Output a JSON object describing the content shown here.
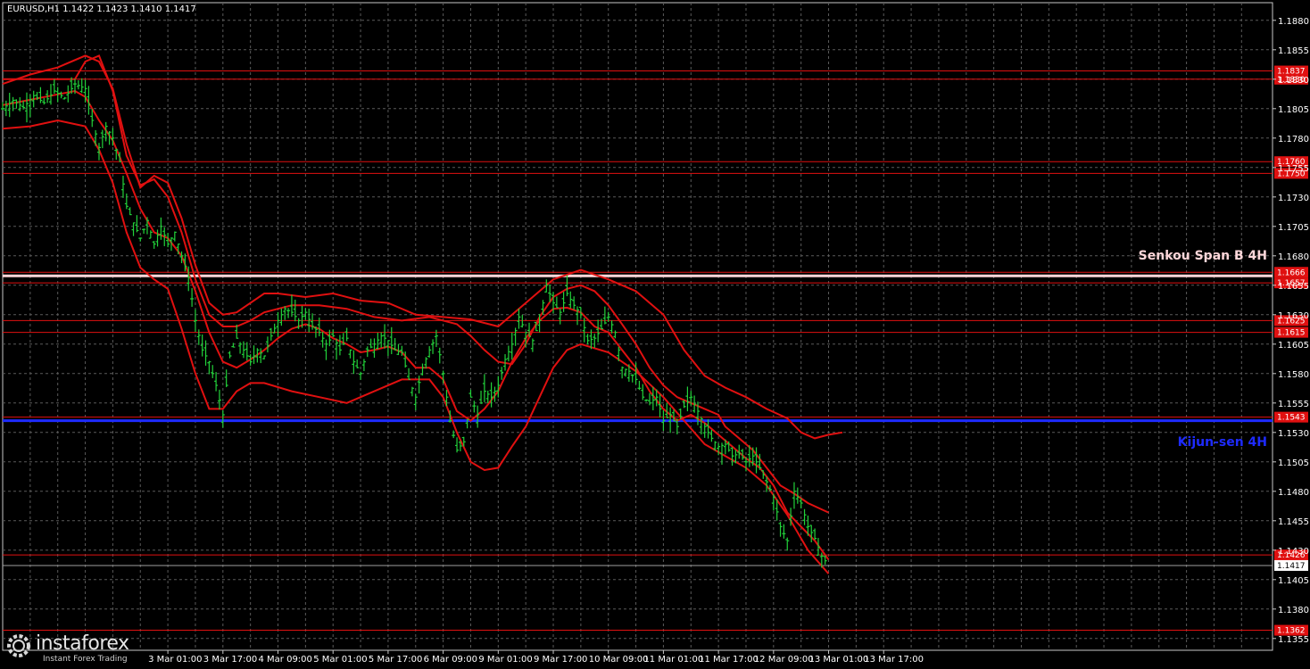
{
  "header": {
    "title": "EURUSD,H1  1.1422 1.1423 1.1410 1.1417"
  },
  "brand": {
    "name": "instaforex",
    "tagline": "Instant Forex Trading",
    "logo_icon": "gear-logo-icon"
  },
  "labels": {
    "senkou": "Senkou Span B 4H",
    "kijun": "Kijun-sen 4H"
  },
  "colors": {
    "background": "#000000",
    "candles": "#22d13a",
    "levels": "#e01010",
    "kijun": "#1e2bff",
    "senkou": "#ffd7da",
    "grid": "#5a5a5a"
  },
  "chart_data": {
    "type": "line",
    "title": "EURUSD,H1",
    "ylim": [
      1.1345,
      1.1895
    ],
    "grid": true,
    "y_ticks": [
      "1.1880",
      "1.1855",
      "1.1830",
      "1.1805",
      "1.1780",
      "1.1755",
      "1.1730",
      "1.1705",
      "1.1680",
      "1.1655",
      "1.1630",
      "1.1605",
      "1.1580",
      "1.1555",
      "1.1530",
      "1.1505",
      "1.1480",
      "1.1455",
      "1.1430",
      "1.1405",
      "1.1380",
      "1.1355"
    ],
    "x_ticks": [
      {
        "label": "3 Mar 01:00",
        "x": 1
      },
      {
        "label": "3 Mar 17:00",
        "x": 17
      },
      {
        "label": "4 Mar 09:00",
        "x": 33
      },
      {
        "label": "5 Mar 01:00",
        "x": 49
      },
      {
        "label": "5 Mar 17:00",
        "x": 65
      },
      {
        "label": "6 Mar 09:00",
        "x": 81
      },
      {
        "label": "9 Mar 01:00",
        "x": 97
      },
      {
        "label": "9 Mar 17:00",
        "x": 113
      },
      {
        "label": "10 Mar 09:00",
        "x": 129
      },
      {
        "label": "11 Mar 01:00",
        "x": 145
      },
      {
        "label": "11 Mar 17:00",
        "x": 161
      },
      {
        "label": "12 Mar 09:00",
        "x": 177
      },
      {
        "label": "13 Mar 01:00",
        "x": 193
      },
      {
        "label": "13 Mar 17:00",
        "x": 209
      }
    ],
    "x_range": [
      -47,
      322
    ],
    "levels": [
      {
        "value": 1.1837,
        "label": "1.1837"
      },
      {
        "value": 1.183,
        "label": "1.1830"
      },
      {
        "value": 1.176,
        "label": "1.1760"
      },
      {
        "value": 1.175,
        "label": "1.1750"
      },
      {
        "value": 1.1666,
        "label": "1.1666"
      },
      {
        "value": 1.1657,
        "label": "1.1657"
      },
      {
        "value": 1.1625,
        "label": "1.1625"
      },
      {
        "value": 1.1615,
        "label": "1.1615"
      },
      {
        "value": 1.1543,
        "label": "1.1543"
      },
      {
        "value": 1.1426,
        "label": "1.1426"
      },
      {
        "value": 1.1362,
        "label": "1.1362"
      }
    ],
    "current_price": {
      "value": 1.1417,
      "label": "1.1417"
    },
    "senkou_span_b": 1.1663,
    "kijun_sen": 1.154,
    "close_series": [
      [
        -47,
        1.1805
      ],
      [
        -44,
        1.1812
      ],
      [
        -41,
        1.1806
      ],
      [
        -38,
        1.1816
      ],
      [
        -35,
        1.181
      ],
      [
        -32,
        1.182
      ],
      [
        -29,
        1.1814
      ],
      [
        -26,
        1.1826
      ],
      [
        -23,
        1.1822
      ],
      [
        -21,
        1.1795
      ],
      [
        -19,
        1.1772
      ],
      [
        -17,
        1.179
      ],
      [
        -15,
        1.178
      ],
      [
        -13,
        1.176
      ],
      [
        -11,
        1.1722
      ],
      [
        -9,
        1.1708
      ],
      [
        -7,
        1.1695
      ],
      [
        -5,
        1.171
      ],
      [
        -3,
        1.169
      ],
      [
        -1,
        1.1705
      ],
      [
        1,
        1.169
      ],
      [
        3,
        1.17
      ],
      [
        5,
        1.168
      ],
      [
        7,
        1.1662
      ],
      [
        9,
        1.1625
      ],
      [
        11,
        1.16
      ],
      [
        13,
        1.159
      ],
      [
        15,
        1.157
      ],
      [
        17,
        1.1545
      ],
      [
        19,
        1.1595
      ],
      [
        21,
        1.161
      ],
      [
        23,
        1.16
      ],
      [
        25,
        1.159
      ],
      [
        27,
        1.16
      ],
      [
        29,
        1.1595
      ],
      [
        31,
        1.1612
      ],
      [
        33,
        1.1625
      ],
      [
        35,
        1.1635
      ],
      [
        37,
        1.1632
      ],
      [
        39,
        1.1625
      ],
      [
        41,
        1.1632
      ],
      [
        43,
        1.162
      ],
      [
        45,
        1.1615
      ],
      [
        47,
        1.1605
      ],
      [
        49,
        1.1612
      ],
      [
        51,
        1.16
      ],
      [
        53,
        1.161
      ],
      [
        55,
        1.159
      ],
      [
        57,
        1.158
      ],
      [
        59,
        1.16
      ],
      [
        61,
        1.1605
      ],
      [
        63,
        1.1612
      ],
      [
        65,
        1.1608
      ],
      [
        67,
        1.16
      ],
      [
        69,
        1.1598
      ],
      [
        71,
        1.1575
      ],
      [
        73,
        1.156
      ],
      [
        75,
        1.1585
      ],
      [
        77,
        1.16
      ],
      [
        79,
        1.1612
      ],
      [
        81,
        1.158
      ],
      [
        83,
        1.154
      ],
      [
        85,
        1.1515
      ],
      [
        87,
        1.1522
      ],
      [
        89,
        1.156
      ],
      [
        91,
        1.1545
      ],
      [
        93,
        1.1565
      ],
      [
        95,
        1.156
      ],
      [
        97,
        1.157
      ],
      [
        99,
        1.1592
      ],
      [
        101,
        1.1605
      ],
      [
        103,
        1.1628
      ],
      [
        105,
        1.1615
      ],
      [
        107,
        1.1608
      ],
      [
        109,
        1.1625
      ],
      [
        111,
        1.1655
      ],
      [
        113,
        1.164
      ],
      [
        115,
        1.1632
      ],
      [
        117,
        1.1648
      ],
      [
        119,
        1.1638
      ],
      [
        121,
        1.163
      ],
      [
        123,
        1.1608
      ],
      [
        125,
        1.161
      ],
      [
        127,
        1.1618
      ],
      [
        129,
        1.1628
      ],
      [
        131,
        1.1615
      ],
      [
        133,
        1.1585
      ],
      [
        135,
        1.1582
      ],
      [
        137,
        1.1575
      ],
      [
        139,
        1.156
      ],
      [
        141,
        1.1555
      ],
      [
        143,
        1.156
      ],
      [
        145,
        1.154
      ],
      [
        147,
        1.1545
      ],
      [
        149,
        1.1535
      ],
      [
        151,
        1.1552
      ],
      [
        153,
        1.156
      ],
      [
        155,
        1.1548
      ],
      [
        157,
        1.1535
      ],
      [
        159,
        1.1525
      ],
      [
        161,
        1.1518
      ],
      [
        163,
        1.152
      ],
      [
        165,
        1.151
      ],
      [
        167,
        1.1512
      ],
      [
        169,
        1.1505
      ],
      [
        171,
        1.151
      ],
      [
        173,
        1.15
      ],
      [
        175,
        1.1488
      ],
      [
        177,
        1.1475
      ],
      [
        179,
        1.145
      ],
      [
        181,
        1.1438
      ],
      [
        183,
        1.148
      ],
      [
        185,
        1.147
      ],
      [
        187,
        1.145
      ],
      [
        189,
        1.144
      ],
      [
        191,
        1.1425
      ],
      [
        193,
        1.1417
      ]
    ],
    "tenkan": [
      [
        -47,
        1.1808
      ],
      [
        -40,
        1.1812
      ],
      [
        -33,
        1.1816
      ],
      [
        -26,
        1.182
      ],
      [
        -23,
        1.1815
      ],
      [
        -19,
        1.1795
      ],
      [
        -15,
        1.1778
      ],
      [
        -11,
        1.175
      ],
      [
        -7,
        1.172
      ],
      [
        -3,
        1.17
      ],
      [
        1,
        1.1695
      ],
      [
        5,
        1.168
      ],
      [
        9,
        1.165
      ],
      [
        13,
        1.1615
      ],
      [
        17,
        1.159
      ],
      [
        21,
        1.1585
      ],
      [
        25,
        1.1592
      ],
      [
        29,
        1.16
      ],
      [
        33,
        1.161
      ],
      [
        37,
        1.1618
      ],
      [
        41,
        1.1622
      ],
      [
        45,
        1.1618
      ],
      [
        49,
        1.161
      ],
      [
        53,
        1.1605
      ],
      [
        57,
        1.1598
      ],
      [
        61,
        1.16
      ],
      [
        65,
        1.1603
      ],
      [
        69,
        1.1598
      ],
      [
        73,
        1.1585
      ],
      [
        77,
        1.1585
      ],
      [
        81,
        1.1575
      ],
      [
        85,
        1.1548
      ],
      [
        89,
        1.154
      ],
      [
        93,
        1.155
      ],
      [
        97,
        1.1565
      ],
      [
        101,
        1.159
      ],
      [
        105,
        1.161
      ],
      [
        109,
        1.1625
      ],
      [
        113,
        1.1635
      ],
      [
        117,
        1.1636
      ],
      [
        121,
        1.1632
      ],
      [
        125,
        1.162
      ],
      [
        129,
        1.1615
      ],
      [
        133,
        1.16
      ],
      [
        137,
        1.1585
      ],
      [
        141,
        1.1565
      ],
      [
        145,
        1.155
      ],
      [
        149,
        1.154
      ],
      [
        153,
        1.1545
      ],
      [
        157,
        1.1538
      ],
      [
        161,
        1.1528
      ],
      [
        165,
        1.1518
      ],
      [
        169,
        1.1508
      ],
      [
        173,
        1.15
      ],
      [
        177,
        1.1485
      ],
      [
        181,
        1.1462
      ],
      [
        185,
        1.145
      ],
      [
        189,
        1.1438
      ],
      [
        193,
        1.1422
      ]
    ],
    "kijun": [
      [
        -47,
        1.183
      ],
      [
        -38,
        1.183
      ],
      [
        -26,
        1.183
      ],
      [
        -23,
        1.1845
      ],
      [
        -19,
        1.185
      ],
      [
        -15,
        1.182
      ],
      [
        -11,
        1.1765
      ],
      [
        -7,
        1.174
      ],
      [
        -3,
        1.1745
      ],
      [
        1,
        1.173
      ],
      [
        5,
        1.17
      ],
      [
        9,
        1.166
      ],
      [
        13,
        1.163
      ],
      [
        17,
        1.162
      ],
      [
        21,
        1.162
      ],
      [
        25,
        1.1625
      ],
      [
        29,
        1.1632
      ],
      [
        37,
        1.1638
      ],
      [
        45,
        1.1638
      ],
      [
        53,
        1.1635
      ],
      [
        61,
        1.1628
      ],
      [
        69,
        1.1625
      ],
      [
        77,
        1.1628
      ],
      [
        85,
        1.1622
      ],
      [
        89,
        1.1612
      ],
      [
        93,
        1.16
      ],
      [
        97,
        1.159
      ],
      [
        101,
        1.1588
      ],
      [
        105,
        1.1605
      ],
      [
        109,
        1.1628
      ],
      [
        113,
        1.1645
      ],
      [
        117,
        1.1652
      ],
      [
        121,
        1.1655
      ],
      [
        125,
        1.165
      ],
      [
        129,
        1.1638
      ],
      [
        133,
        1.1622
      ],
      [
        137,
        1.1605
      ],
      [
        141,
        1.1585
      ],
      [
        145,
        1.157
      ],
      [
        149,
        1.156
      ],
      [
        153,
        1.1555
      ],
      [
        157,
        1.155
      ],
      [
        161,
        1.1545
      ],
      [
        163,
        1.1535
      ],
      [
        167,
        1.1525
      ],
      [
        171,
        1.1515
      ],
      [
        175,
        1.15
      ],
      [
        179,
        1.1485
      ],
      [
        183,
        1.1478
      ],
      [
        187,
        1.147
      ],
      [
        193,
        1.1462
      ]
    ],
    "bb_upper": [
      [
        -47,
        1.1826
      ],
      [
        -39,
        1.1834
      ],
      [
        -31,
        1.184
      ],
      [
        -23,
        1.185
      ],
      [
        -19,
        1.1845
      ],
      [
        -15,
        1.1822
      ],
      [
        -11,
        1.1775
      ],
      [
        -7,
        1.1738
      ],
      [
        -3,
        1.1748
      ],
      [
        1,
        1.1742
      ],
      [
        5,
        1.1712
      ],
      [
        9,
        1.1672
      ],
      [
        13,
        1.164
      ],
      [
        17,
        1.163
      ],
      [
        21,
        1.1632
      ],
      [
        25,
        1.164
      ],
      [
        29,
        1.1648
      ],
      [
        33,
        1.1648
      ],
      [
        41,
        1.1645
      ],
      [
        49,
        1.1648
      ],
      [
        57,
        1.1642
      ],
      [
        65,
        1.164
      ],
      [
        73,
        1.163
      ],
      [
        81,
        1.1628
      ],
      [
        89,
        1.1626
      ],
      [
        97,
        1.162
      ],
      [
        105,
        1.164
      ],
      [
        113,
        1.166
      ],
      [
        121,
        1.1668
      ],
      [
        129,
        1.166
      ],
      [
        137,
        1.165
      ],
      [
        145,
        1.163
      ],
      [
        151,
        1.16
      ],
      [
        157,
        1.1578
      ],
      [
        163,
        1.1568
      ],
      [
        169,
        1.156
      ],
      [
        175,
        1.155
      ],
      [
        181,
        1.1542
      ],
      [
        185,
        1.153
      ],
      [
        189,
        1.1525
      ],
      [
        193,
        1.1528
      ],
      [
        197,
        1.153
      ]
    ],
    "bb_lower": [
      [
        -47,
        1.1788
      ],
      [
        -39,
        1.179
      ],
      [
        -31,
        1.1795
      ],
      [
        -23,
        1.179
      ],
      [
        -19,
        1.177
      ],
      [
        -15,
        1.1742
      ],
      [
        -11,
        1.17
      ],
      [
        -7,
        1.167
      ],
      [
        -3,
        1.166
      ],
      [
        1,
        1.1652
      ],
      [
        5,
        1.1618
      ],
      [
        9,
        1.158
      ],
      [
        13,
        1.155
      ],
      [
        17,
        1.155
      ],
      [
        21,
        1.1565
      ],
      [
        25,
        1.1572
      ],
      [
        29,
        1.1572
      ],
      [
        37,
        1.1565
      ],
      [
        45,
        1.156
      ],
      [
        53,
        1.1555
      ],
      [
        61,
        1.1565
      ],
      [
        69,
        1.1575
      ],
      [
        77,
        1.1575
      ],
      [
        81,
        1.156
      ],
      [
        85,
        1.153
      ],
      [
        89,
        1.1505
      ],
      [
        93,
        1.1498
      ],
      [
        97,
        1.15
      ],
      [
        101,
        1.1518
      ],
      [
        105,
        1.1535
      ],
      [
        109,
        1.156
      ],
      [
        113,
        1.1585
      ],
      [
        117,
        1.16
      ],
      [
        121,
        1.1605
      ],
      [
        129,
        1.1598
      ],
      [
        137,
        1.1582
      ],
      [
        145,
        1.156
      ],
      [
        151,
        1.154
      ],
      [
        157,
        1.152
      ],
      [
        163,
        1.151
      ],
      [
        169,
        1.15
      ],
      [
        175,
        1.1485
      ],
      [
        181,
        1.146
      ],
      [
        187,
        1.143
      ],
      [
        193,
        1.141
      ]
    ]
  }
}
